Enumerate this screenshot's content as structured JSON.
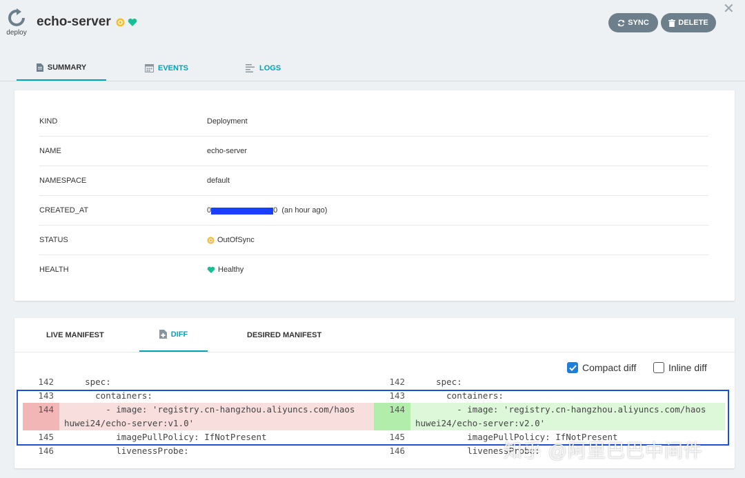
{
  "app": {
    "kind_label": "deploy",
    "title": "echo-server"
  },
  "toolbar": {
    "sync_label": "SYNC",
    "delete_label": "DELETE"
  },
  "tabs": [
    {
      "label": "SUMMARY",
      "icon": "document-icon",
      "active": true
    },
    {
      "label": "EVENTS",
      "icon": "calendar-icon",
      "active": false
    },
    {
      "label": "LOGS",
      "icon": "lines-icon",
      "active": false
    }
  ],
  "summary": {
    "rows": [
      {
        "key": "KIND",
        "value": "Deployment"
      },
      {
        "key": "NAME",
        "value": "echo-server"
      },
      {
        "key": "NAMESPACE",
        "value": "default"
      },
      {
        "key": "CREATED_AT",
        "value_prefix": "0",
        "value_suffix": "0",
        "relative": "(an hour ago)"
      },
      {
        "key": "STATUS",
        "value": "OutOfSync"
      },
      {
        "key": "HEALTH",
        "value": "Healthy"
      }
    ]
  },
  "colors": {
    "accent": "#00a2b3",
    "button": "#6d7f8b",
    "out_of_sync": "#f4c030",
    "healthy": "#18be94",
    "redaction": "#1a3fff"
  },
  "manifest_tabs": [
    {
      "label": "LIVE MANIFEST",
      "active": false
    },
    {
      "label": "DIFF",
      "active": true
    },
    {
      "label": "DESIRED MANIFEST",
      "active": false
    }
  ],
  "diff_options": {
    "compact_label": "Compact diff",
    "compact_checked": true,
    "inline_label": "Inline diff",
    "inline_checked": false
  },
  "diff": {
    "left": [
      {
        "num": "142",
        "text": "    spec:"
      },
      {
        "num": "143",
        "text": "      containers:"
      },
      {
        "num": "144",
        "text": "        - image: 'registry.cn-hangzhou.aliyuncs.com/haos",
        "cont": "huwei24/echo-server:v1.0'",
        "type": "removed"
      },
      {
        "num": "145",
        "text": "          imagePullPolicy: IfNotPresent"
      },
      {
        "num": "146",
        "text": "          livenessProbe:"
      }
    ],
    "right": [
      {
        "num": "142",
        "text": "    spec:"
      },
      {
        "num": "143",
        "text": "      containers:"
      },
      {
        "num": "144",
        "text": "        - image: 'registry.cn-hangzhou.aliyuncs.com/haos",
        "cont": "huwei24/echo-server:v2.0'",
        "type": "added"
      },
      {
        "num": "145",
        "text": "          imagePullPolicy: IfNotPresent"
      },
      {
        "num": "146",
        "text": "          livenessProbe:"
      }
    ]
  },
  "watermark": "知乎 @阿里巴巴中间件"
}
